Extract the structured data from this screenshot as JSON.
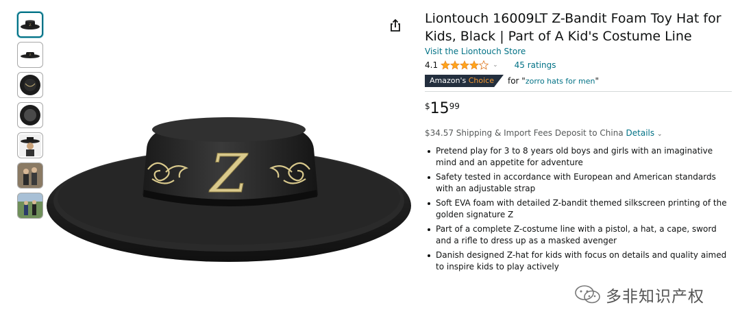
{
  "product": {
    "title": "Liontouch 16009LT Z-Bandit Foam Toy Hat for Kids, Black | Part of A Kid's Costume Line",
    "store_link": "Visit the Liontouch Store",
    "rating_value": "4.1",
    "rating_stars": 4.1,
    "ratings_count": "45 ratings",
    "badge_prefix": "Amazon's",
    "badge_suffix": "Choice",
    "badge_for": "for \"",
    "badge_keyword": "zorro hats for men",
    "badge_close": "\"",
    "price_symbol": "$",
    "price_whole": "15",
    "price_fraction": "99",
    "shipping_text": "$34.57 Shipping & Import Fees Deposit to China",
    "shipping_details": "Details",
    "bullets": [
      "Pretend play for 3 to 8 years old boys and girls with an imaginative mind and an appetite for adventure",
      "Safety tested in accordance with European and American standards with an adjustable strap",
      "Soft EVA foam with detailed Z-bandit themed silkscreen printing of the golden signature Z",
      "Part of a complete Z-costume line with a pistol, a hat, a cape, sword and a rifle to dress up as a masked avenger",
      "Danish designed Z-hat for kids with focus on details and quality aimed to inspire kids to play actively"
    ]
  },
  "gallery": {
    "thumbnails": [
      "hat-front",
      "hat-side",
      "hat-top",
      "hat-bottom",
      "hat-on-mannequin",
      "kids-in-costume",
      "kids-outdoors"
    ],
    "selected_index": 0
  },
  "watermark": {
    "text": "多非知识产权"
  },
  "colors": {
    "link": "#007185",
    "badge_bg": "#232F3E",
    "badge_accent": "#F69931",
    "star": "#FFA41C",
    "text": "#0F1111"
  }
}
